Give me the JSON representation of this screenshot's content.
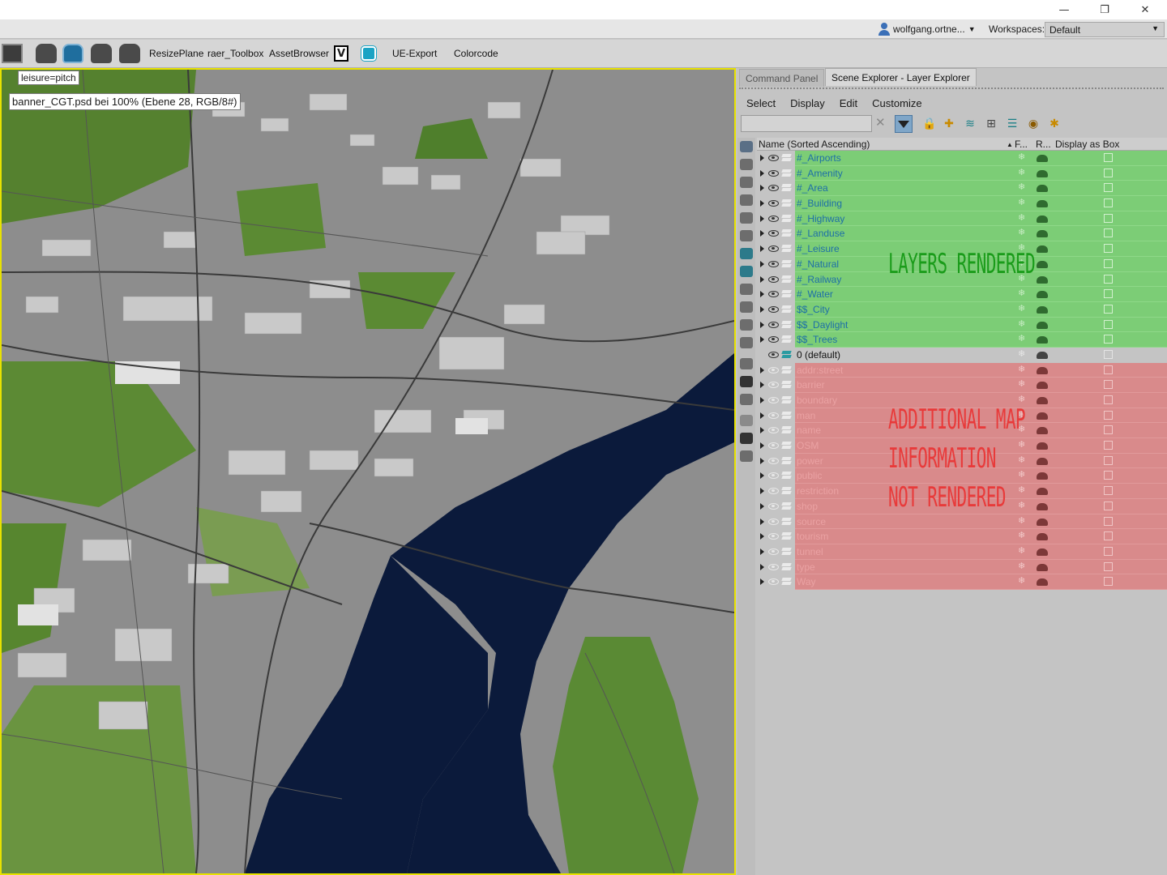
{
  "window_controls": {
    "minimize": "—",
    "maximize": "❐",
    "close": "✕"
  },
  "account": {
    "user": "wolfgang.ortne...",
    "workspaces_label": "Workspaces:",
    "workspace_value": "Default"
  },
  "toolbar": {
    "items": [
      "ResizePlane",
      "raer_Toolbox",
      "AssetBrowser",
      "UE-Export",
      "Colorcode"
    ],
    "v_label": "V"
  },
  "viewport": {
    "tooltip_top": "leisure=pitch",
    "tooltip_file": "banner_CGT.psd bei 100% (Ebene 28, RGB/8#)",
    "colors": {
      "water": "#0c1a3a",
      "ground": "#8c8c8c",
      "green": "#5d8a36",
      "border": "#e8e200"
    }
  },
  "panel": {
    "tabs": [
      "Command Panel",
      "Scene Explorer - Layer Explorer"
    ],
    "menu": [
      "Select",
      "Display",
      "Edit",
      "Customize"
    ],
    "filter_placeholder": "",
    "columns": {
      "name": "Name (Sorted Ascending)",
      "sort_indicator": "▲",
      "freeze": "F...",
      "render": "R...",
      "display_box": "Display as Box"
    }
  },
  "layers_rendered": [
    "#_Airports",
    "#_Amenity",
    "#_Area",
    "#_Building",
    "#_Highway",
    "#_Landuse",
    "#_Leisure",
    "#_Natural",
    "#_Railway",
    "#_Water",
    "$$_City",
    "$$_Daylight",
    "$$_Trees"
  ],
  "default_layer": "0 (default)",
  "layers_not_rendered": [
    "addr:street",
    "barrier",
    "boundary",
    "man",
    "name",
    "OSM",
    "power",
    "public",
    "restriction",
    "shop",
    "source",
    "tourism",
    "tunnel",
    "type",
    "Way"
  ],
  "annotations": {
    "rendered": "LAYERS RENDERED",
    "not_rendered_1": "ADDITIONAL MAP",
    "not_rendered_2": "INFORMATION",
    "not_rendered_3": "NOT RENDERED",
    "green_color": "#1a9c1a",
    "red_color": "#e83a3a"
  },
  "row_colors": {
    "rendered": "#7ccd76",
    "default": "#c4c4c4",
    "not_rendered": "#d98a8b"
  }
}
